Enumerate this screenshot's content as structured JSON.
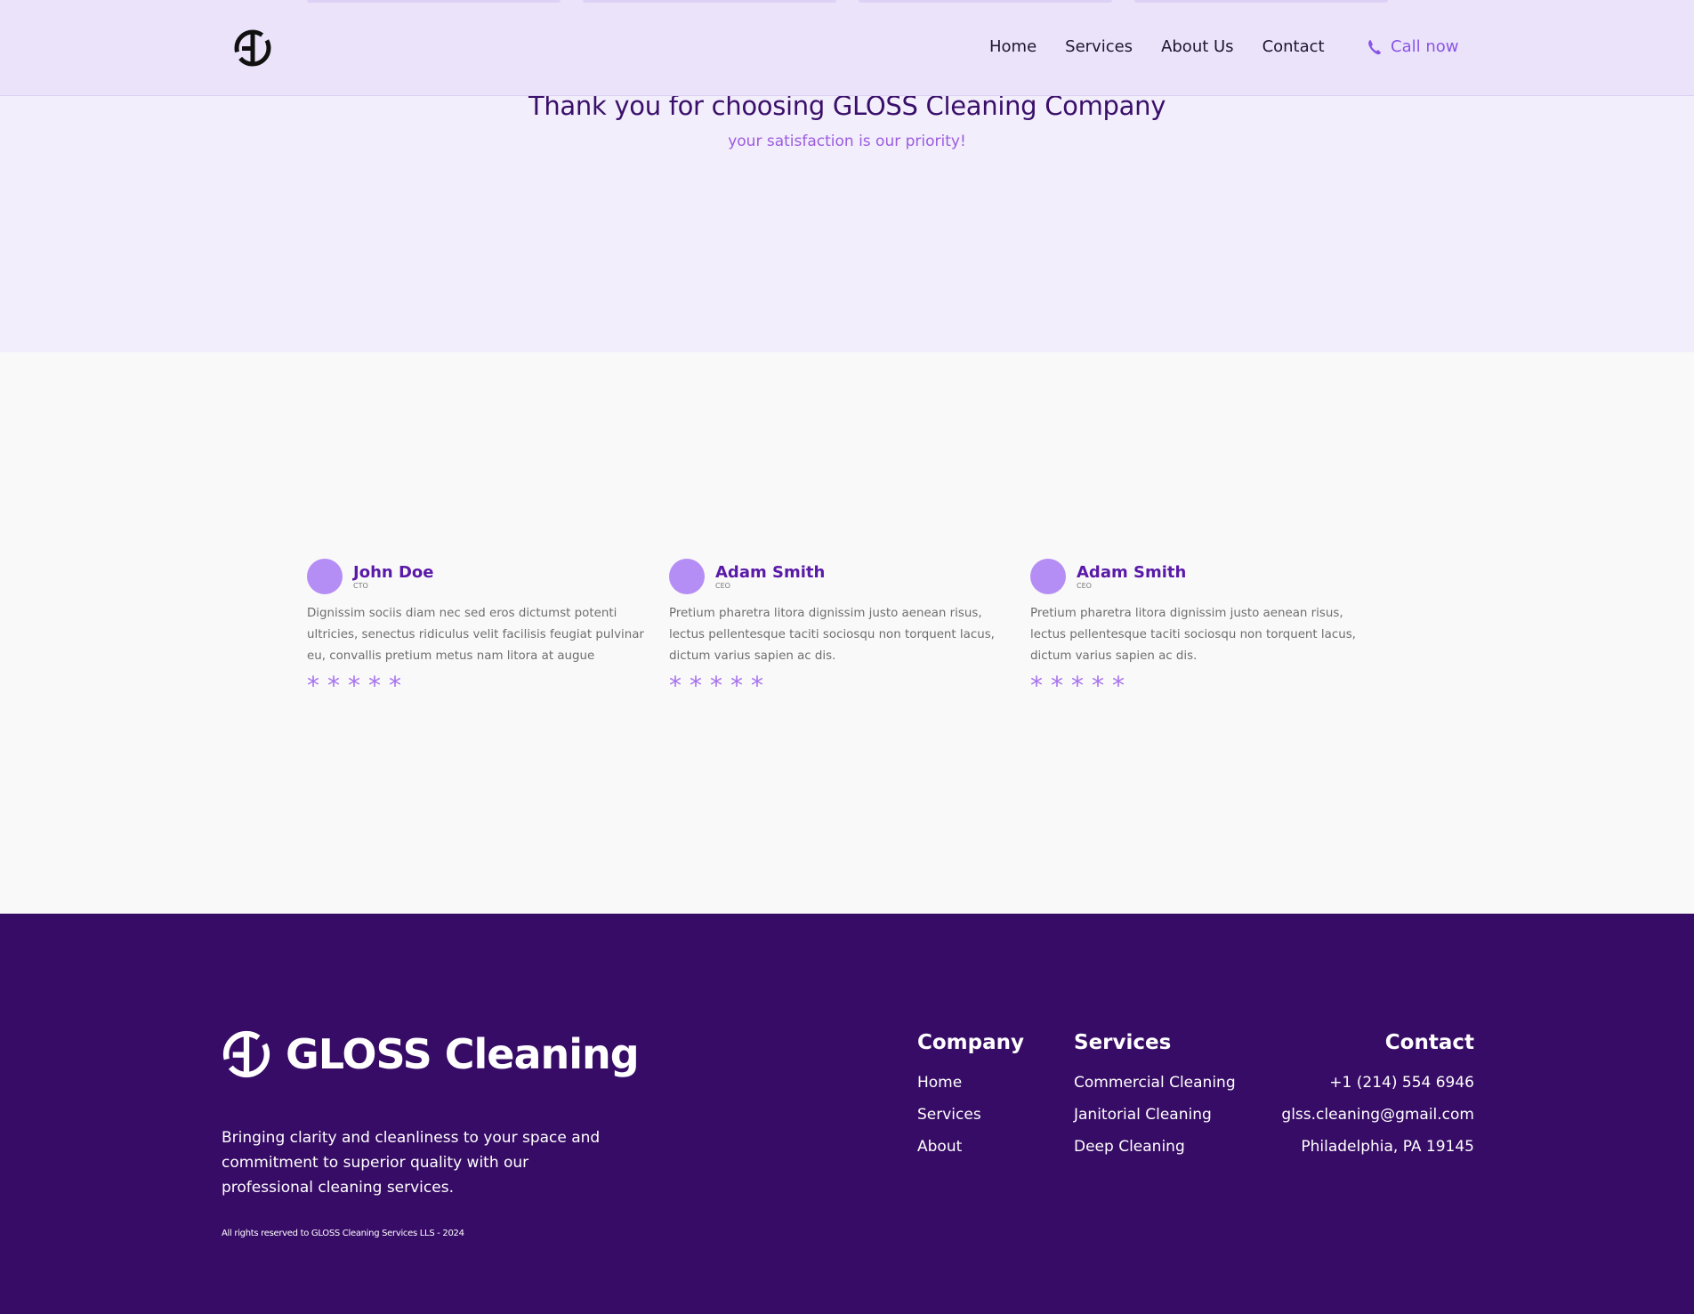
{
  "nav": {
    "links": [
      "Home",
      "Services",
      "About Us",
      "Contact"
    ],
    "call_label": "Call now"
  },
  "hero": {
    "title": "Thank you for choosing GLOSS Cleaning Company",
    "subtitle": "your satisfaction is our priority!"
  },
  "testimonials": [
    {
      "name": "John Doe",
      "role": "CTO",
      "quote": "Dignissim sociis diam nec sed eros dictumst potenti ultricies, senectus ridiculus velit facilisis feugiat pulvinar eu, convallis pretium metus nam litora at augue",
      "stars": 5
    },
    {
      "name": "Adam Smith",
      "role": "CEO",
      "quote": "Pretium pharetra litora dignissim justo aenean risus, lectus pellentesque taciti sociosqu non torquent lacus, dictum varius sapien ac dis.",
      "stars": 5
    },
    {
      "name": "Adam Smith",
      "role": "CEO",
      "quote": "Pretium pharetra litora dignissim justo aenean risus, lectus pellentesque taciti sociosqu non torquent lacus, dictum varius sapien ac dis.",
      "stars": 5
    }
  ],
  "footer": {
    "brand": "GLOSS Cleaning",
    "description": "Bringing clarity and cleanliness to your space and commitment to superior quality with our professional cleaning services.",
    "rights": "All rights reserved to GLOSS Cleaning Services LLS - 2024",
    "company": {
      "title": "Company",
      "links": [
        "Home",
        "Services",
        "About"
      ]
    },
    "services": {
      "title": "Services",
      "links": [
        "Commercial Cleaning",
        "Janitorial Cleaning",
        "Deep Cleaning"
      ]
    },
    "contact": {
      "title": "Contact",
      "links": [
        "+1 (214) 554 6946",
        "glss.cleaning@gmail.com",
        "Philadelphia, PA 19145"
      ]
    }
  },
  "colors": {
    "accent": "#8a55e6",
    "footer_bg": "#370c66",
    "nav_bg": "#eae3fa"
  }
}
